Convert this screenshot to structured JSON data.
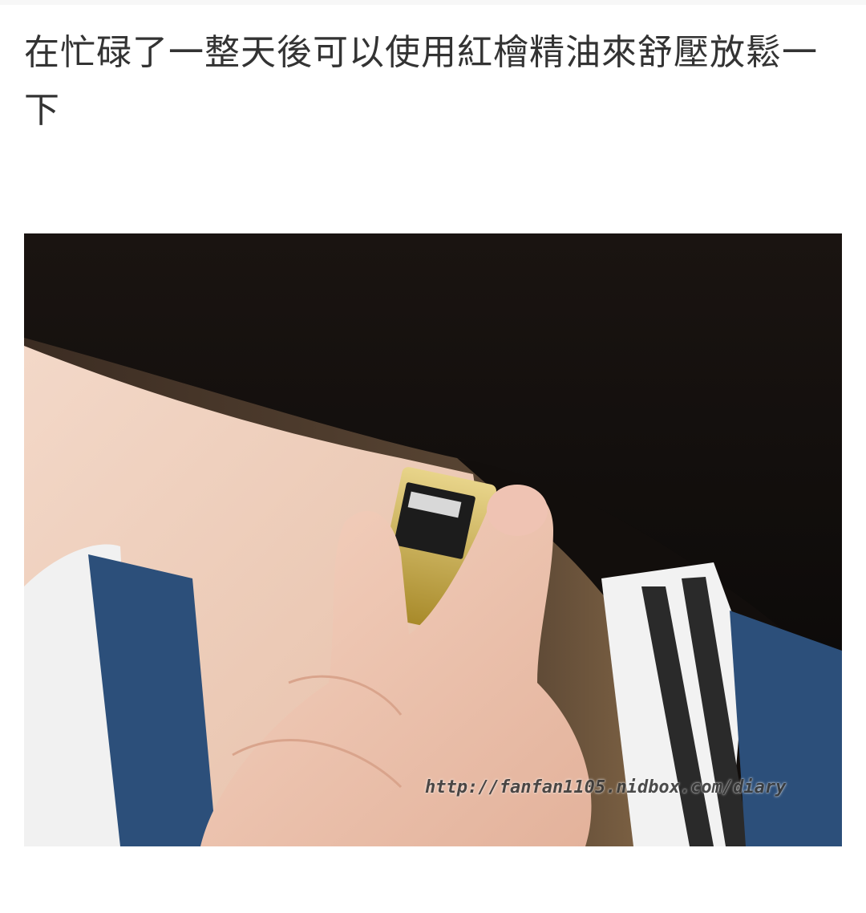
{
  "article": {
    "heading": "在忙碌了一整天後可以使用紅檜精油來舒壓放鬆一下"
  },
  "photo": {
    "watermark": "http://fanfan1105.nidbox.com/diary"
  }
}
